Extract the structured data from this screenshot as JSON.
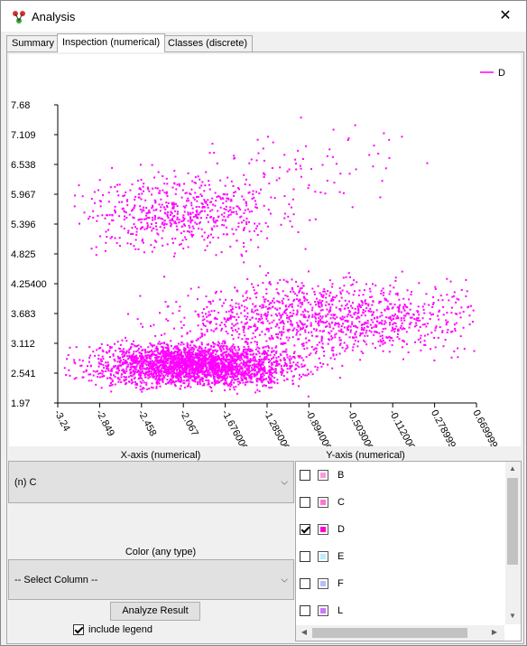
{
  "window": {
    "title": "Analysis",
    "close_symbol": "✕",
    "app_icon": "network-nodes-icon"
  },
  "tabs": [
    {
      "label": "Summary",
      "active": false
    },
    {
      "label": "Inspection (numerical)",
      "active": true
    },
    {
      "label": "Classes (discrete)",
      "active": false
    }
  ],
  "chart_data": {
    "type": "scatter",
    "legend": {
      "entries": [
        "D"
      ],
      "position": "top-right",
      "colors": [
        "#ff00ff"
      ]
    },
    "series": [
      {
        "name": "D",
        "color": "#ff00ff"
      }
    ],
    "xlim": [
      -3.24,
      0.669999
    ],
    "ylim": [
      1.97,
      7.68
    ],
    "x_tick_labels": [
      "-3.24",
      "-2.849",
      "-2.458",
      "-2.067",
      "-1.676000",
      "-1.285000",
      "-0.894000",
      "-0.503000",
      "-0.112000",
      "0.278999",
      "0.669999"
    ],
    "y_tick_labels": [
      "7.68",
      "7.109",
      "6.538",
      "5.967",
      "5.396",
      "4.825",
      "4.25400",
      "3.683",
      "3.112",
      "2.541",
      "1.97"
    ],
    "clusters": [
      {
        "description": "dense lower cluster",
        "center_x": -1.95,
        "center_y": 2.7,
        "spread_x": 0.45,
        "spread_y": 0.2,
        "count": 2600
      },
      {
        "description": "middle band",
        "center_x": -0.7,
        "center_y": 3.6,
        "spread_x": 0.7,
        "spread_y": 0.35,
        "count": 1200
      },
      {
        "description": "upper cluster",
        "center_x": -2.05,
        "center_y": 5.6,
        "spread_x": 0.45,
        "spread_y": 0.35,
        "count": 600
      },
      {
        "description": "sparse upper scatter",
        "center_x": -0.9,
        "center_y": 6.5,
        "spread_x": 0.6,
        "spread_y": 0.4,
        "count": 80
      }
    ]
  },
  "controls": {
    "x_axis_label": "X-axis (numerical)",
    "y_axis_label": "Y-axis (numerical)",
    "x_axis_selected": "(n) C",
    "color_label": "Color (any type)",
    "color_selected": "-- Select Column --",
    "analyze_button": "Analyze Result",
    "include_legend_label": "include legend",
    "include_legend_checked": true,
    "chevron": "⌵"
  },
  "y_columns": [
    {
      "label": "B",
      "checked": false,
      "color": "#ff99dd"
    },
    {
      "label": "C",
      "checked": false,
      "color": "#ff77cc"
    },
    {
      "label": "D",
      "checked": true,
      "color": "#ff00cc"
    },
    {
      "label": "E",
      "checked": false,
      "color": "#bbeeff"
    },
    {
      "label": "F",
      "checked": false,
      "color": "#bbbbff"
    },
    {
      "label": "L",
      "checked": false,
      "color": "#cc77ff"
    }
  ]
}
